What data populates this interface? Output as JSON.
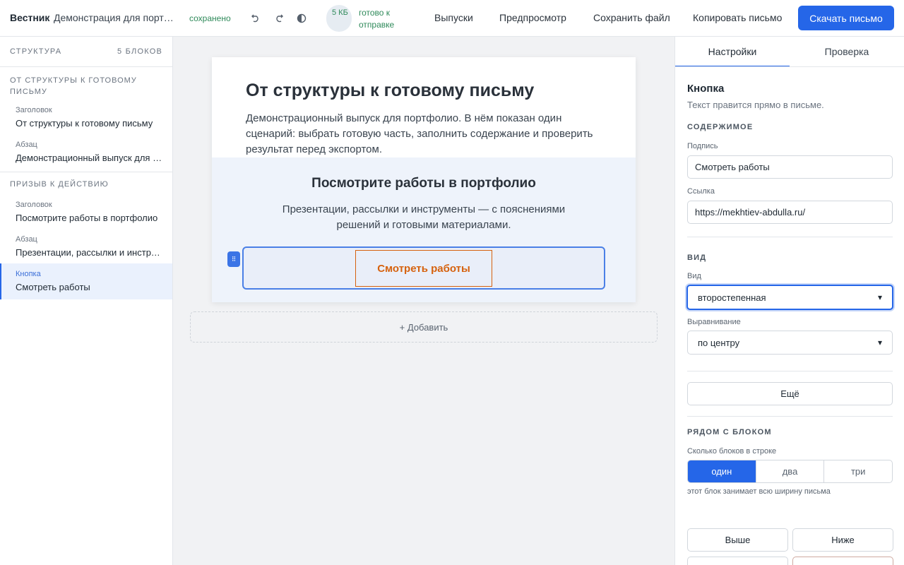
{
  "topbar": {
    "brand": "Вестник",
    "doc_title": "Демонстрация для портфолио",
    "saved_status": "сохранено",
    "size": "5 КБ",
    "ready": "готово к отправке",
    "links": [
      "Выпуски",
      "Предпросмотр",
      "Сохранить файл",
      "Копировать письмо"
    ],
    "download": "Скачать письмо"
  },
  "sidebar": {
    "title": "Структура",
    "count": "5 блоков",
    "groups": [
      {
        "label": "От структуры к готовому письму",
        "items": [
          {
            "type": "Заголовок",
            "text": "От структуры к готовому письму"
          },
          {
            "type": "Абзац",
            "text": "Демонстрационный выпуск для портфолио"
          }
        ]
      },
      {
        "label": "Призыв к действию",
        "items": [
          {
            "type": "Заголовок",
            "text": "Посмотрите работы в портфолио"
          },
          {
            "type": "Абзац",
            "text": "Презентации, рассылки и инструменты"
          },
          {
            "type": "Кнопка",
            "text": "Смотреть работы"
          }
        ]
      }
    ]
  },
  "email": {
    "title": "От структуры к готовому письму",
    "intro": "Демонстрационный выпуск для портфолио. В нём показан один сценарий: выбрать готовую часть, заполнить содержание и проверить результат перед экспортом.",
    "cta_title": "Посмотрите работы в портфолио",
    "cta_text": "Презентации, рассылки и инструменты — с пояснениями решений и готовыми материалами.",
    "cta_button": "Смотреть работы",
    "handle": "⠿",
    "add": "+ Добавить"
  },
  "panel": {
    "tabs": [
      "Настройки",
      "Проверка"
    ],
    "block_title": "Кнопка",
    "block_sub": "Текст правится прямо в письме.",
    "content_section": "Содержимое",
    "caption_label": "Подпись",
    "caption_value": "Смотреть работы",
    "link_label": "Ссылка",
    "link_value": "https://mekhtiev-abdulla.ru/",
    "view_section": "Вид",
    "view_label": "Вид",
    "view_value": "второстепенная",
    "align_label": "Выравнивание",
    "align_value": "по центру",
    "more": "Ещё",
    "near_section": "Рядом с блоком",
    "per_row_label": "Сколько блоков в строке",
    "per_row_options": [
      "один",
      "два",
      "три"
    ],
    "per_row_selected": "один",
    "per_row_hint": "этот блок занимает всю ширину письма",
    "move_up": "Выше",
    "move_down": "Ниже"
  },
  "colors": {
    "accent": "#2566e8",
    "cta_orange": "#d6620f",
    "saved_green": "#2f8a5a"
  }
}
